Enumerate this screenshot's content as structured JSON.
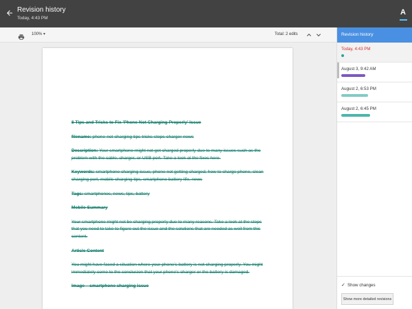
{
  "header": {
    "title": "Revision history",
    "subtitle": "Today, 4:43 PM",
    "avatar_letter": "A"
  },
  "toolbar": {
    "zoom": "100%",
    "zoom_caret": "▾",
    "total_edits": "Total: 2 edits"
  },
  "document": {
    "heading": "8 Tips and Tricks to Fix 'Phone Not Charging Properly' Issue",
    "filename_label": "filename:",
    "filename_value": "phone-not-charging-tips-tricks-steps-charger-news",
    "description_label": "Description:",
    "description_value": "Your smartphone might not get charged properly due to many issues such as the problem with the cable, charger, or USB port. Take a look at the fixes here.",
    "keywords_label": "Keywords:",
    "keywords_value": "smartphone charging issue, phone not getting charged, how to charge phone, clean charging port, mobile charging tips, smartphone battery life, news",
    "tags_label": "Tags:",
    "tags_value": "smartphones, news, tips, battery",
    "mobile_summary_heading": "Mobile Summary",
    "mobile_summary_text": "Your smartphone might not be charging properly due to many reasons. Take a look at the steps that you need to take to figure out the issue and the solutions that are needed as well from this content.",
    "article_content_heading": "Article Content",
    "article_content_text": "You might have faced a situation where your phone's battery is not charging properly. You might immediately come to the conclusion that your phone's charger or the battery is damaged.",
    "image_line": "Image – smartphone charging issue"
  },
  "sidebar": {
    "title": "Revision history",
    "revisions": [
      {
        "date": "Today, 4:43 PM",
        "color": "#26a69a",
        "bar_fill": 0.05,
        "current": true
      },
      {
        "date": "August 3, 9:42 AM",
        "color": "#7e57c2",
        "bar_fill": 0.5,
        "current": false
      },
      {
        "date": "August 2, 6:53 PM",
        "color": "#80cbc4",
        "bar_fill": 0.55,
        "current": false
      },
      {
        "date": "August 2, 6:45 PM",
        "color": "#4db6ac",
        "bar_fill": 0.6,
        "current": false
      }
    ],
    "show_changes_label": "Show changes",
    "show_changes_checked": "✓",
    "detailed_button": "Show more detailed revisions"
  }
}
